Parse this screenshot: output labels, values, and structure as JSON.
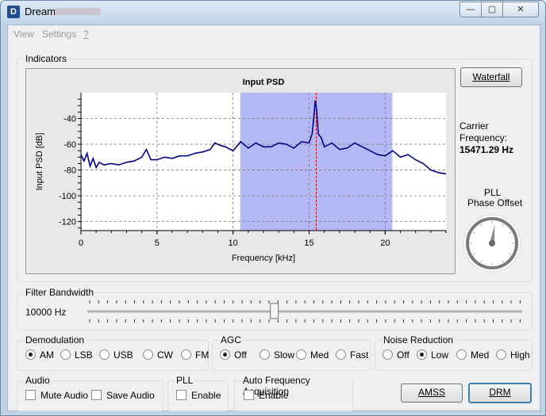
{
  "window": {
    "icon_letter": "D",
    "title": "Dream",
    "min_glyph": "—",
    "max_glyph": "▢",
    "close_glyph": "✕"
  },
  "menu": {
    "view_label": "View",
    "settings_label": "Settings",
    "help_label": "?"
  },
  "indicators": {
    "group_label": "Indicators",
    "waterfall_label": "Waterfall",
    "carrier_label_line1": "Carrier",
    "carrier_label_line2": "Frequency:",
    "carrier_value": "15471.29 Hz",
    "pll_line1": "PLL",
    "pll_line2": "Phase Offset",
    "pll_offset_deg": 8
  },
  "chart_data": {
    "type": "line",
    "title": "Input PSD",
    "xlabel": "Frequency [kHz]",
    "ylabel": "Input PSD [dB]",
    "xlim": [
      0,
      24
    ],
    "ylim": [
      -127,
      -20
    ],
    "xticks": [
      "0",
      "5",
      "10",
      "15",
      "20"
    ],
    "yticks": [
      "-40",
      "-60",
      "-80",
      "-100",
      "-120"
    ],
    "grid": true,
    "highlight_band_khz": [
      10.47,
      20.47
    ],
    "carrier_marker_khz": 15.47,
    "colors": {
      "line": "#00008b",
      "band": "#b4b8f4",
      "marker": "#d00000"
    },
    "series": [
      {
        "x": [
          0,
          0.2,
          0.4,
          0.6,
          0.8,
          1.0,
          1.2,
          1.5,
          2,
          2.5,
          3,
          3.5,
          4,
          4.3,
          4.6,
          5,
          5.5,
          6,
          6.5,
          7,
          7.5,
          8,
          8.5,
          8.8,
          9.2,
          9.5,
          10,
          10.5,
          11,
          11.5,
          12,
          12.5,
          13,
          13.5,
          14,
          14.5,
          15,
          15.2,
          15.3,
          15.4,
          15.5,
          15.6,
          15.8,
          16,
          16.5,
          17,
          17.5,
          18,
          18.5,
          19,
          19.5,
          20,
          20.5,
          21,
          21.5,
          22,
          22.5,
          23,
          23.5,
          24
        ],
        "values": [
          -68,
          -73,
          -67,
          -77,
          -71,
          -78,
          -74,
          -76,
          -75,
          -76,
          -74,
          -73,
          -70,
          -64,
          -72,
          -72,
          -70,
          -71,
          -69,
          -69,
          -67,
          -66,
          -64,
          -59,
          -61,
          -62,
          -65,
          -58,
          -63,
          -59,
          -62,
          -62,
          -59,
          -60,
          -63,
          -58,
          -59,
          -52,
          -40,
          -26,
          -34,
          -52,
          -55,
          -62,
          -59,
          -64,
          -63,
          -59,
          -62,
          -65,
          -68,
          -69,
          -65,
          -70,
          -68,
          -72,
          -75,
          -80,
          -82,
          -83
        ]
      }
    ]
  },
  "filter": {
    "group_label": "Filter Bandwidth",
    "value_text": "10000 Hz",
    "slider_fraction": 0.43
  },
  "demodulation": {
    "group_label": "Demodulation",
    "options": [
      "AM",
      "LSB",
      "USB",
      "CW",
      "FM"
    ],
    "selected": "AM"
  },
  "agc": {
    "group_label": "AGC",
    "options": [
      "Off",
      "Slow",
      "Med",
      "Fast"
    ],
    "selected": "Off"
  },
  "noise": {
    "group_label": "Noise Reduction",
    "options": [
      "Off",
      "Low",
      "Med",
      "High"
    ],
    "selected": "Low"
  },
  "audio": {
    "group_label": "Audio",
    "mute_label": "Mute Audio",
    "save_label": "Save Audio"
  },
  "pll": {
    "group_label": "PLL",
    "enable_label": "Enable"
  },
  "afa": {
    "group_label": "Auto Frequency Acquisition",
    "enable_label": "Enable"
  },
  "buttons": {
    "amss_label": "AMSS",
    "drm_label": "DRM"
  }
}
